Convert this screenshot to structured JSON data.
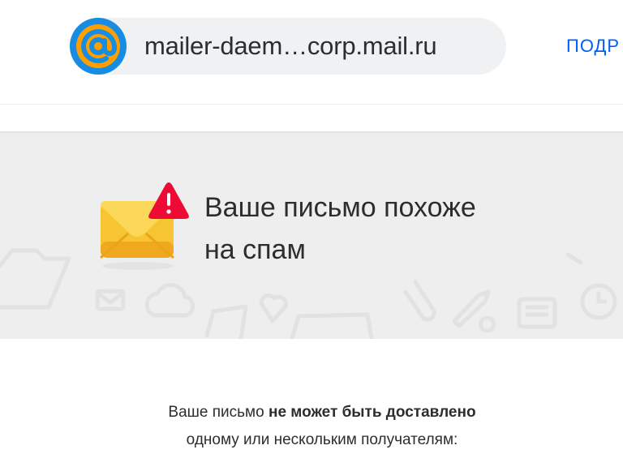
{
  "header": {
    "sender": "mailer-daem…corp.mail.ru",
    "details_link": "ПОДР"
  },
  "banner": {
    "title_line1": "Ваше письмо похоже",
    "title_line2": "на спам"
  },
  "message": {
    "prefix": "Ваше письмо ",
    "bold": "не может быть доставлено",
    "line2": "одному или нескольким получателям:"
  },
  "colors": {
    "link": "#005ff9",
    "banner_bg": "#eeeeee",
    "avatar_blue": "#168de2",
    "avatar_orange": "#ff9e00",
    "warning_red": "#ed0a34",
    "envelope_yellow": "#f7c531"
  },
  "icons": {
    "avatar": "mail-ru-at-logo-icon",
    "envelope": "envelope-warning-icon"
  }
}
